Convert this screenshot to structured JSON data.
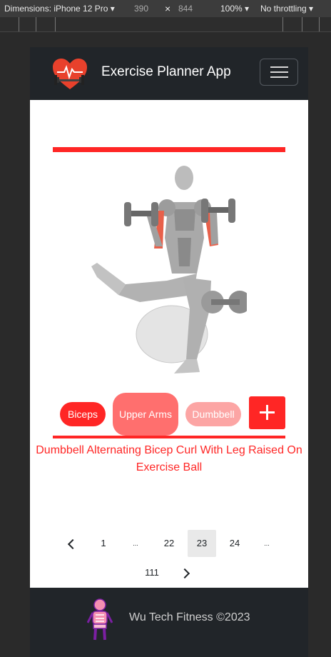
{
  "devtools": {
    "device_label": "Dimensions: iPhone 12 Pro",
    "width": "390",
    "times": "×",
    "height": "844",
    "zoom": "100%",
    "throttling": "No throttling",
    "dropdown_caret": "▾"
  },
  "header": {
    "brand": "Exercise Planner App"
  },
  "exercise": {
    "tags": [
      "Biceps",
      "Upper Arms",
      "Dumbbell"
    ],
    "add_label": "+",
    "name": "Dumbbell Alternating Bicep Curl With Leg Raised On Exercise Ball"
  },
  "pagination": {
    "items": [
      "1",
      "...",
      "22",
      "23",
      "24",
      "...",
      "111"
    ],
    "active": "23"
  },
  "footer": {
    "text": "Wu Tech Fitness ©2023"
  },
  "colors": {
    "accent": "#ff2625",
    "tag_biceps": "#ff2625",
    "tag_upper_arms": "#ff6f6e",
    "tag_dumbbell": "#fca5a4",
    "navbar": "#212529"
  }
}
